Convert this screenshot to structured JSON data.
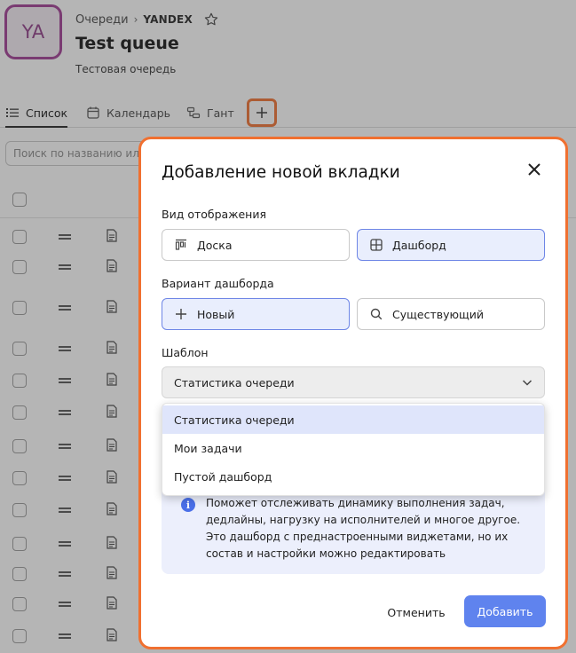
{
  "colors": {
    "accent": "#5f83ee",
    "highlight_border": "#f07030",
    "avatar_border": "#a03a94",
    "selected_bg": "#e9eefd"
  },
  "page": {
    "avatar_text": "YA",
    "breadcrumb": {
      "root": "Очереди",
      "separator": "›",
      "org": "YANDEX"
    },
    "title": "Test queue",
    "subtitle": "Тестовая очередь",
    "tabs": [
      {
        "label": "Список",
        "icon": "list-icon"
      },
      {
        "label": "Календарь",
        "icon": "calendar-icon"
      },
      {
        "label": "Гант",
        "icon": "gantt-icon"
      }
    ],
    "search_placeholder": "Поиск по названию или"
  },
  "modal": {
    "title": "Добавление новой вкладки",
    "view_label": "Вид отображения",
    "view_options": [
      {
        "label": "Доска",
        "icon": "board-icon",
        "selected": false
      },
      {
        "label": "Дашборд",
        "icon": "dashboard-icon",
        "selected": true
      }
    ],
    "variant_label": "Вариант дашборда",
    "variant_options": [
      {
        "label": "Новый",
        "icon": "plus-icon",
        "selected": true
      },
      {
        "label": "Существующий",
        "icon": "search-icon",
        "selected": false
      }
    ],
    "template_label": "Шаблон",
    "template_value": "Статистика очереди",
    "template_options": [
      "Статистика очереди",
      "Мои задачи",
      "Пустой дашборд"
    ],
    "info_icon": "i",
    "info_text": "Поможет отслеживать динамику выполнения задач, дедлайны, нагрузку на исполнителей и многое другое. Это дашборд с преднастроенными виджетами, но их состав и настройки можно редактировать",
    "cancel_label": "Отменить",
    "add_label": "Добавить"
  }
}
